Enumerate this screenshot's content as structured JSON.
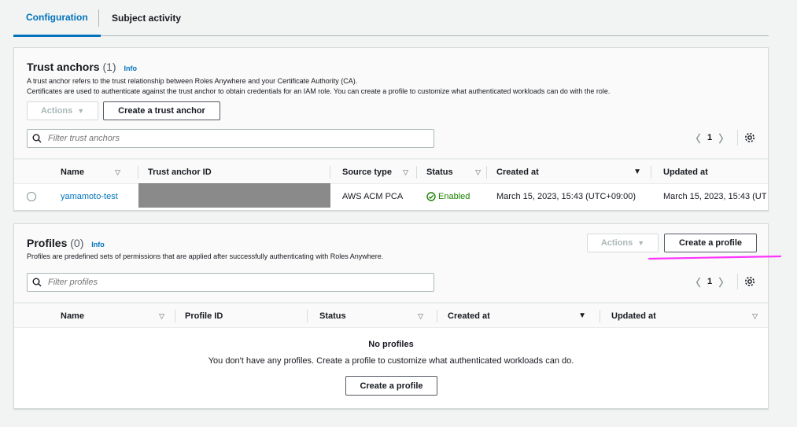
{
  "tabs": [
    {
      "label": "Configuration",
      "active": true
    },
    {
      "label": "Subject activity",
      "active": false
    }
  ],
  "trust_anchors": {
    "title": "Trust anchors",
    "count": "(1)",
    "info": "Info",
    "description_line1": "A trust anchor refers to the trust relationship between Roles Anywhere and your Certificate Authority (CA).",
    "description_line2": "Certificates are used to authenticate against the trust anchor to obtain credentials for an IAM role. You can create a profile to customize what authenticated workloads can do with the role.",
    "actions_label": "Actions",
    "create_label": "Create a trust anchor",
    "filter_placeholder": "Filter trust anchors",
    "page": "1",
    "columns": [
      "Name",
      "Trust anchor ID",
      "Source type",
      "Status",
      "Created at",
      "Updated at"
    ],
    "rows": [
      {
        "name": "yamamoto-test",
        "id": "",
        "source_type": "AWS ACM PCA",
        "status": "Enabled",
        "created_at": "March 15, 2023, 15:43 (UTC+09:00)",
        "updated_at": "March 15, 2023, 15:43 (UT"
      }
    ]
  },
  "profiles": {
    "title": "Profiles",
    "count": "(0)",
    "info": "Info",
    "description": "Profiles are predefined sets of permissions that are applied after successfully authenticating with Roles Anywhere.",
    "actions_label": "Actions",
    "create_label": "Create a profile",
    "filter_placeholder": "Filter profiles",
    "page": "1",
    "columns": [
      "Name",
      "Profile ID",
      "Status",
      "Created at",
      "Updated at"
    ],
    "empty_title": "No profiles",
    "empty_desc": "You don't have any profiles. Create a profile to customize what authenticated workloads can do.",
    "empty_create_label": "Create a profile"
  },
  "colors": {
    "accent": "#0073bb",
    "success": "#1d8102",
    "highlight": "#ff33ff",
    "redaction": "#8a8a8a"
  }
}
